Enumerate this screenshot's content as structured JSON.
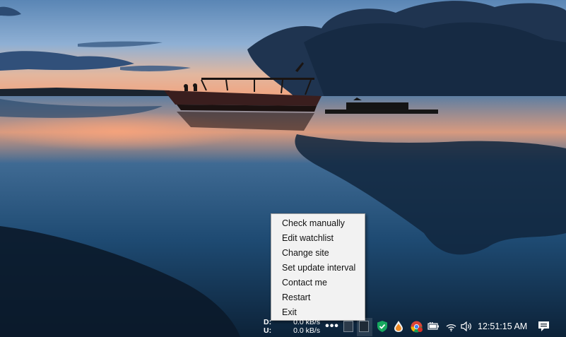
{
  "context_menu": {
    "items": [
      "Check manually",
      "Edit watchlist",
      "Change site",
      "Set update interval",
      "Contact me",
      "Restart",
      "Exit"
    ]
  },
  "taskbar": {
    "network_monitor": {
      "download_label": "D:",
      "download_value": "0.0 kB/s",
      "upload_label": "U:",
      "upload_value": "0.0 kB/s"
    },
    "overflow_label": "•••",
    "clock": "12:51:15 AM",
    "tray_icons": [
      "shield-icon",
      "water-drop-icon",
      "chrome-icon",
      "battery-icon",
      "wifi-icon",
      "volume-icon",
      "notification-icon"
    ]
  },
  "colors": {
    "menu_background": "#f2f2f2",
    "menu_text": "#111111",
    "shield_green": "#17a85f"
  }
}
